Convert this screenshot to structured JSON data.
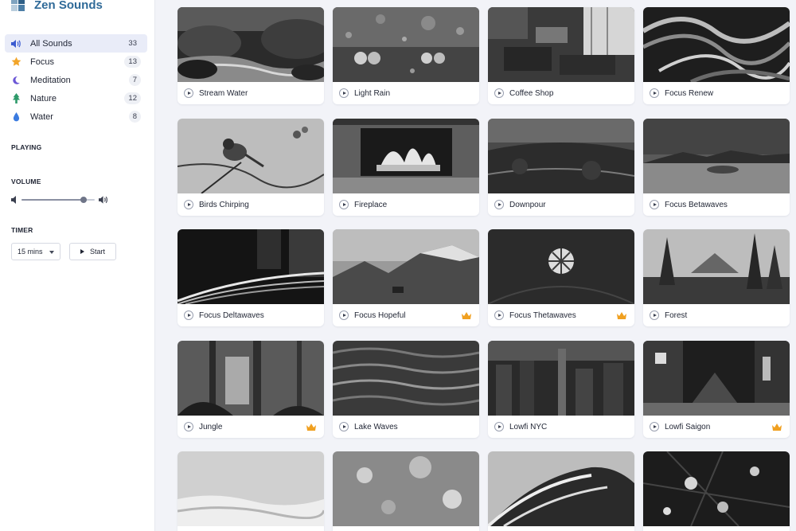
{
  "app": {
    "name": "Zen Sounds"
  },
  "sidebar": {
    "categories": [
      {
        "label": "All Sounds",
        "count": "33",
        "icon": "volume-icon"
      },
      {
        "label": "Focus",
        "count": "13",
        "icon": "star-icon"
      },
      {
        "label": "Meditation",
        "count": "7",
        "icon": "moon-icon"
      },
      {
        "label": "Nature",
        "count": "12",
        "icon": "tree-icon"
      },
      {
        "label": "Water",
        "count": "8",
        "icon": "water-drop-icon"
      }
    ],
    "playing_title": "PLAYING",
    "volume_title": "VOLUME",
    "volume_level": 0.85,
    "timer_title": "TIMER",
    "timer_select_value": "15 mins",
    "timer_start_label": "Start"
  },
  "colors": {
    "accent": "#2f6a98",
    "premium": "#f0a020",
    "active_bg": "#e9ecf8"
  },
  "sounds": [
    {
      "title": "Stream Water",
      "premium": false
    },
    {
      "title": "Light Rain",
      "premium": false
    },
    {
      "title": "Coffee Shop",
      "premium": false
    },
    {
      "title": "Focus Renew",
      "premium": false
    },
    {
      "title": "Birds Chirping",
      "premium": false
    },
    {
      "title": "Fireplace",
      "premium": false
    },
    {
      "title": "Downpour",
      "premium": false
    },
    {
      "title": "Focus Betawaves",
      "premium": false
    },
    {
      "title": "Focus Deltawaves",
      "premium": false
    },
    {
      "title": "Focus Hopeful",
      "premium": true
    },
    {
      "title": "Focus Thetawaves",
      "premium": true
    },
    {
      "title": "Forest",
      "premium": false
    },
    {
      "title": "Jungle",
      "premium": true
    },
    {
      "title": "Lake Waves",
      "premium": false
    },
    {
      "title": "Lowfi NYC",
      "premium": false
    },
    {
      "title": "Lowfi Saigon",
      "premium": true
    },
    {
      "title": "",
      "premium": false
    },
    {
      "title": "",
      "premium": false
    },
    {
      "title": "",
      "premium": false
    },
    {
      "title": "",
      "premium": false
    }
  ]
}
